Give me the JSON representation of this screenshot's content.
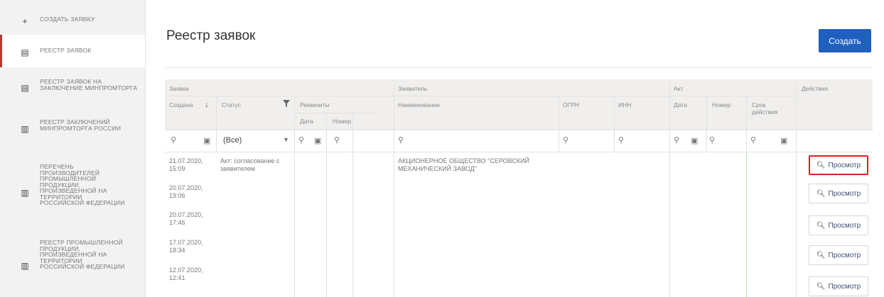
{
  "sidebar": {
    "items": [
      {
        "icon": "plus-icon",
        "label": "СОЗДАТЬ ЗАЯВКУ"
      },
      {
        "icon": "document-icon",
        "label": "РЕЕСТР ЗАЯВОК"
      },
      {
        "icon": "document-icon",
        "label": "РЕЕСТР ЗАЯВОК НА ЗАКЛЮЧЕНИЕ МИНПРОМТОРГА"
      },
      {
        "icon": "book-icon",
        "label": "РЕЕСТР ЗАКЛЮЧЕНИЙ МИНПРОМТОРГА РОССИИ"
      },
      {
        "icon": "book-icon",
        "label": "ПЕРЕЧЕНЬ ПРОИЗВОДИТЕЛЕЙ ПРОМЫШЛЕННОЙ ПРОДУКЦИИ, ПРОИЗВЕДЕННОЙ НА ТЕРРИТОРИИ РОССИЙСКОЙ ФЕДЕРАЦИИ"
      },
      {
        "icon": "book-icon",
        "label": "РЕЕСТР ПРОМЫШЛЕННОЙ ПРОДУКЦИИ, ПРОИЗВЕДЕННОЙ НА ТЕРРИТОРИИ РОССИЙСКОЙ ФЕДЕРАЦИИ"
      }
    ]
  },
  "page": {
    "title": "Реестр заявок",
    "create_label": "Создать"
  },
  "table": {
    "groups": {
      "zayavka": "Заявка",
      "zayavitel": "Заявитель",
      "akt": "Акт",
      "actions": "Действия"
    },
    "headers": {
      "created": "Создана",
      "sort_arrow": "↓",
      "status": "Статус",
      "requisites": "Реквизиты",
      "req_date": "Дата",
      "req_number": "Номер",
      "name": "Наименование",
      "ogrn": "ОГРН",
      "inn": "ИНН",
      "akt_date": "Дата",
      "akt_number": "Номер",
      "validity": "Срок действия"
    },
    "filter": {
      "status_value": "(Все)"
    },
    "rows": [
      {
        "created": "21.07.2020, 15:09",
        "status": "Акт: согласование с заявителем",
        "name": "АКЦИОНЕРНОЕ ОБЩЕСТВО \"СЕРОВСКИЙ МЕХАНИЧЕСКИЙ ЗАВОД\"",
        "action": "Просмотр"
      },
      {
        "created": "20.07.2020, 19:06",
        "status": "",
        "name": "",
        "action": "Просмотр"
      },
      {
        "created": "20.07.2020, 17:46",
        "status": "",
        "name": "",
        "action": "Просмотр"
      },
      {
        "created": "17.07.2020, 18:34",
        "status": "",
        "name": "",
        "action": "Просмотр"
      },
      {
        "created": "12.07.2020, 12:41",
        "status": "",
        "name": "",
        "action": "Просмотр"
      }
    ]
  },
  "colors": {
    "accent": "#1f5fbd",
    "active_marker": "#b43a2e",
    "highlight": "#e02020"
  }
}
